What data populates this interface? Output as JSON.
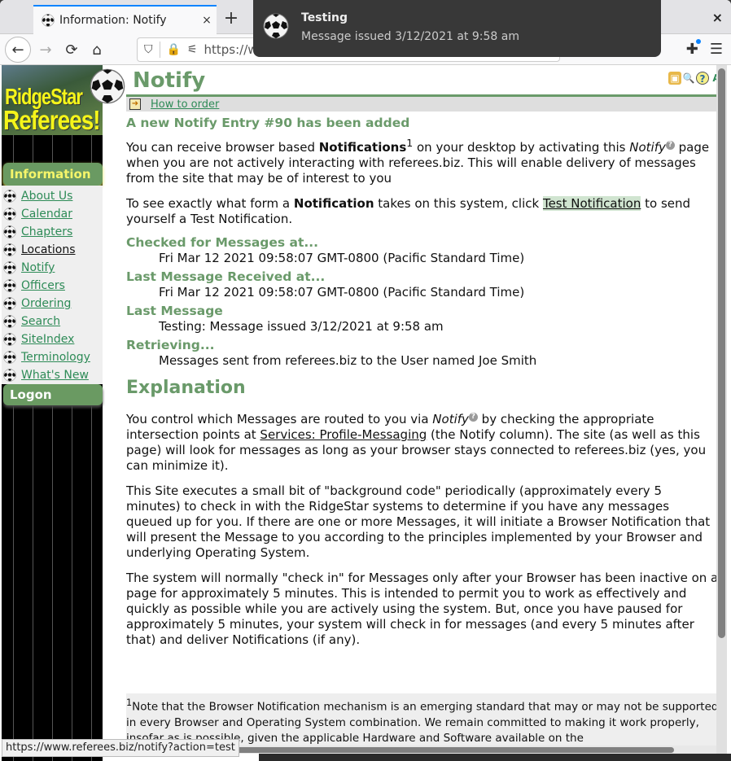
{
  "browser": {
    "tab_title": "Information: Notify",
    "tab_close": "×",
    "new_tab": "+",
    "window_close": "×",
    "url_text": "https://w",
    "nav": {
      "back": "←",
      "forward": "→",
      "reload": "⟳",
      "home": "⌂"
    },
    "icons": {
      "shield": "⛉",
      "lock": "🔒",
      "permissions": "⚟",
      "extensions": "✚",
      "menu": "☰"
    }
  },
  "notification": {
    "title": "Testing",
    "body": "Message issued 3/12/2021 at 9:58 am"
  },
  "sidebar": {
    "logo_line1": "RidgeStar",
    "logo_line2": "Referees!",
    "section_information": "Information",
    "items": [
      {
        "label": "About Us",
        "visited": false
      },
      {
        "label": "Calendar",
        "visited": false
      },
      {
        "label": "Chapters",
        "visited": false
      },
      {
        "label": "Locations",
        "visited": true
      },
      {
        "label": "Notify",
        "visited": false
      },
      {
        "label": "Officers",
        "visited": false
      },
      {
        "label": "Ordering",
        "visited": false
      },
      {
        "label": "Search",
        "visited": false
      },
      {
        "label": "SiteIndex",
        "visited": false
      },
      {
        "label": "Terminology",
        "visited": false
      },
      {
        "label": "What's New",
        "visited": false
      }
    ],
    "section_logon": "Logon"
  },
  "page": {
    "title": "Notify",
    "how_to_order": "How to order",
    "tool_icons": [
      "lock-icon",
      "search-icon",
      "help-icon",
      "text-size-icon"
    ],
    "entry_added": "A new Notify Entry #90 has been added",
    "intro": {
      "p1_a": "You can receive browser based ",
      "p1_bold": "Notifications",
      "p1_sup": "1",
      "p1_b": " on your desktop by activating this ",
      "p1_italic": "Notify",
      "p1_c": " page when you are not actively interacting with referees.biz. This will enable delivery of messages from the site that may be of interest to you",
      "p2_a": "To see exactly what form a ",
      "p2_bold": "Notification",
      "p2_b": " takes on this system, click ",
      "p2_link": "Test Notification",
      "p2_c": " to send yourself a Test Notification."
    },
    "status": [
      {
        "label": "Checked for Messages at...",
        "value": "Fri Mar 12 2021 09:58:07 GMT-0800 (Pacific Standard Time)"
      },
      {
        "label": "Last Message Received at...",
        "value": "Fri Mar 12 2021 09:58:07 GMT-0800 (Pacific Standard Time)"
      },
      {
        "label": "Last Message",
        "value": "Testing: Message issued 3/12/2021 at 9:58 am"
      },
      {
        "label": "Retrieving...",
        "value": "Messages sent from referees.biz to the User named Joe Smith"
      }
    ],
    "explanation": {
      "heading": "Explanation",
      "p1_a": "You control which Messages are routed to you via ",
      "p1_italic": "Notify",
      "p1_b": "  by checking the appropriate intersection points at ",
      "p1_link": "Services: Profile-Messaging",
      "p1_c": " (the Notify column). The site (as well as this page) will look for messages as long as your browser stays connected to referees.biz (yes, you can minimize it).",
      "p2": "This Site executes a small bit of \"background code\" periodically (approximately every 5 minutes) to check in with the RidgeStar systems to determine if you have any messages queued up for you. If there are one or more Messages, it will initiate a Browser Notification that will present the Message to you according to the principles implemented by your Browser and underlying Operating System.",
      "p3": "The system will normally \"check in\" for Messages only after your Browser has been inactive on a page for approximately 5 minutes. This is intended to permit you to work as effectively and quickly as possible while you are actively using the system. But, once you have paused for approximately 5 minutes, your system will check in for messages (and every 5 minutes after that) and deliver Notifications (if any)."
    },
    "footnote": {
      "sup": "1",
      "text": "Note that the Browser Notification mechanism is an emerging standard that may or may not be supported in every Browser and Operating System combination. We remain committed to making it work properly, insofar as is possible, given the applicable Hardware and Software available on the"
    }
  },
  "status_bar": "https://www.referees.biz/notify?action=test",
  "colors": {
    "heading_green": "#6a9a6a",
    "link_green": "#2e8b57",
    "section_bg": "#6a9a62",
    "section_text": "#f5f56a",
    "logo_yellow": "#f5f51a",
    "toast_bg": "#383838"
  }
}
